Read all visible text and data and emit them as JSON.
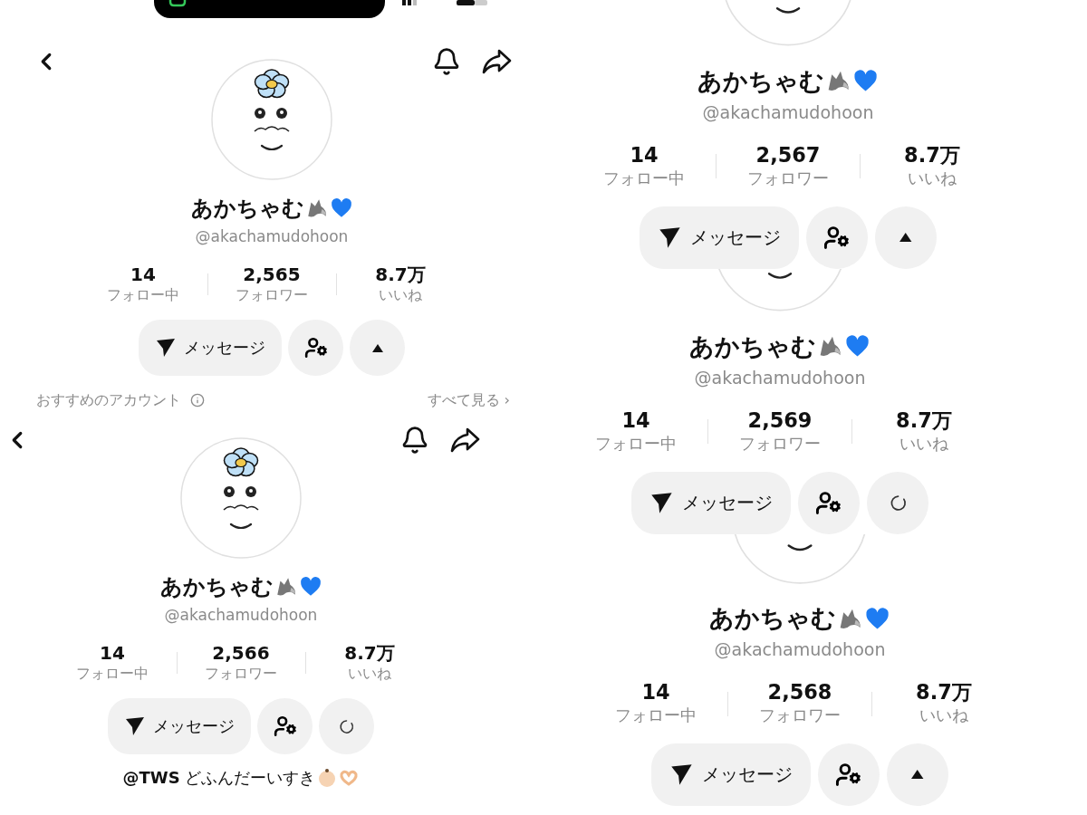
{
  "panels": [
    {
      "status_bar": true,
      "nav": true,
      "avatar": {
        "kind": "full"
      },
      "name": "あかちゃむ",
      "handle": "@akachamudohoon",
      "stats": [
        {
          "value": "14",
          "label": "フォロー中"
        },
        {
          "value": "2,565",
          "label": "フォロワー"
        },
        {
          "value": "8.7万",
          "label": "いいね"
        }
      ],
      "message_button": "メッセージ",
      "third_button": {
        "kind": "collapse"
      },
      "recommended": {
        "title": "おすすめのアカウント",
        "link": "すべて見る ›"
      }
    },
    {
      "status_bar": false,
      "nav": true,
      "avatar": {
        "kind": "full"
      },
      "name": "あかちゃむ",
      "handle": "@akachamudohoon",
      "stats": [
        {
          "value": "14",
          "label": "フォロー中"
        },
        {
          "value": "2,566",
          "label": "フォロワー"
        },
        {
          "value": "8.7万",
          "label": "いいね"
        }
      ],
      "message_button": "メッセージ",
      "third_button": {
        "kind": "loading"
      },
      "bio": "**@TWS** どふんだーいすき"
    },
    {
      "status_bar": false,
      "nav": false,
      "avatar": {
        "kind": "partial"
      },
      "name": "あかちゃむ",
      "handle": "@akachamudohoon",
      "stats": [
        {
          "value": "14",
          "label": "フォロー中"
        },
        {
          "value": "2,567",
          "label": "フォロワー"
        },
        {
          "value": "8.7万",
          "label": "いいね"
        }
      ],
      "message_button": "メッセージ",
      "third_button": {
        "kind": "collapse"
      }
    },
    {
      "status_bar": false,
      "nav": false,
      "avatar": {
        "kind": "partial"
      },
      "name": "あかちゃむ",
      "handle": "@akachamudohoon",
      "stats": [
        {
          "value": "14",
          "label": "フォロー中"
        },
        {
          "value": "2,569",
          "label": "フォロワー"
        },
        {
          "value": "8.7万",
          "label": "いいね"
        }
      ],
      "message_button": "メッセージ",
      "third_button": {
        "kind": "loading"
      }
    },
    {
      "status_bar": false,
      "nav": false,
      "avatar": {
        "kind": "partial"
      },
      "name": "あかちゃむ",
      "handle": "@akachamudohoon",
      "stats": [
        {
          "value": "14",
          "label": "フォロー中"
        },
        {
          "value": "2,568",
          "label": "フォロワー"
        },
        {
          "value": "8.7万",
          "label": "いいね"
        }
      ],
      "message_button": "メッセージ",
      "third_button": {
        "kind": "collapse"
      }
    }
  ]
}
